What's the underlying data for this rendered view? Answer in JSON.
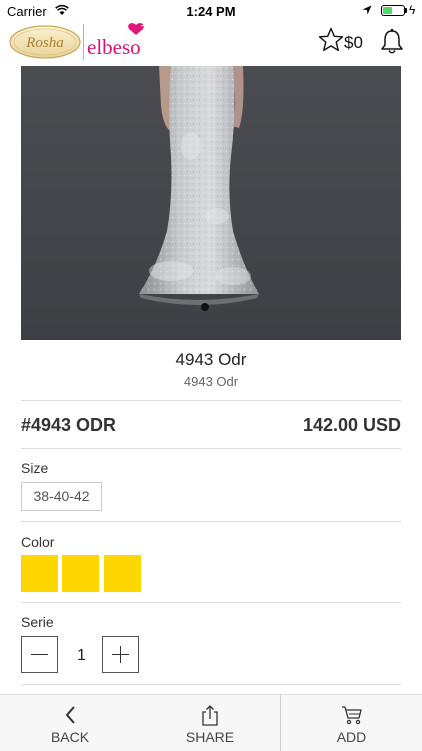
{
  "status_bar": {
    "carrier": "Carrier",
    "time": "1:24 PM"
  },
  "header": {
    "logo_left": "Rosha",
    "logo_right": "elbeso",
    "cart_total": "$0"
  },
  "product": {
    "name": "4943 Odr",
    "subtitle": "4943 Odr",
    "code": "#4943 ODR",
    "price": "142.00 USD"
  },
  "options": {
    "size_label": "Size",
    "size_value": "38-40-42",
    "color_label": "Color",
    "colors": [
      "#ffd600",
      "#ffd600",
      "#ffd600"
    ],
    "serie_label": "Serie",
    "quantity": "1"
  },
  "bottom_bar": {
    "back_label": "BACK",
    "share_label": "SHARE",
    "add_label": "ADD"
  },
  "icons": [
    "wifi-icon",
    "location-icon",
    "battery-icon",
    "star-icon",
    "bell-icon",
    "minus-icon",
    "plus-icon",
    "chevron-left-icon",
    "share-icon",
    "cart-icon"
  ]
}
